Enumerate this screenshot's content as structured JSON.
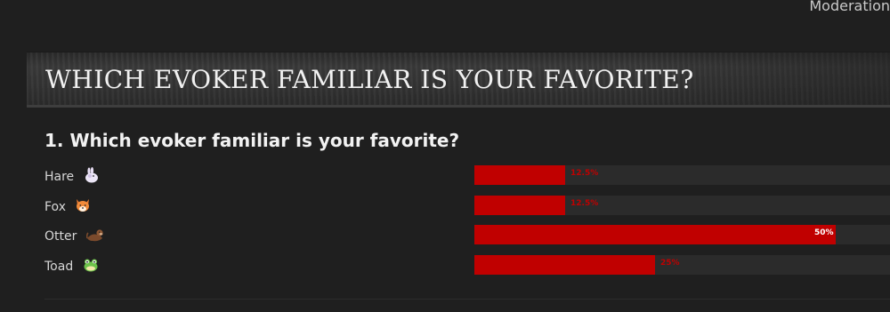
{
  "header": {
    "moderation_link": "Moderation"
  },
  "banner": {
    "title": "WHICH EVOKER FAMILIAR IS YOUR FAVORITE?"
  },
  "poll": {
    "question": "1. Which evoker familiar is your favorite?",
    "bar_color": "#c00000",
    "options": [
      {
        "label": "Hare",
        "icon": "rabbit-icon",
        "percent": 12.5,
        "percent_label": "12.5%"
      },
      {
        "label": "Fox",
        "icon": "fox-icon",
        "percent": 12.5,
        "percent_label": "12.5%"
      },
      {
        "label": "Otter",
        "icon": "otter-icon",
        "percent": 50,
        "percent_label": "50%"
      },
      {
        "label": "Toad",
        "icon": "frog-icon",
        "percent": 25,
        "percent_label": "25%"
      }
    ]
  }
}
